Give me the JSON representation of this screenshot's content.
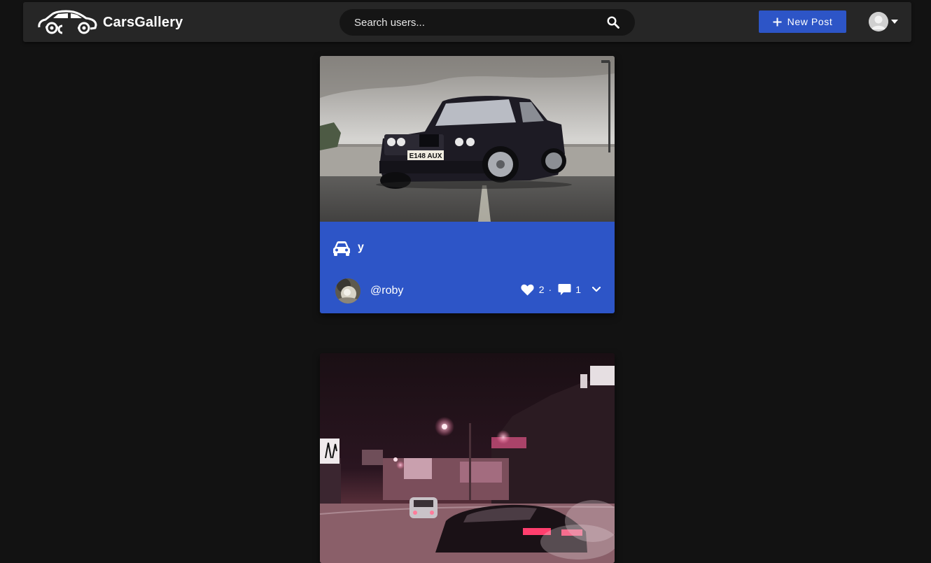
{
  "header": {
    "brand_name": "CarsGallery",
    "brand_icon": "car-logo-icon",
    "search_placeholder": "Search users...",
    "search_icon": "search-icon",
    "new_post_label": "New Post",
    "new_post_icon": "plus-icon",
    "user_avatar_icon": "default-avatar-icon",
    "user_menu_icon": "caret-down-icon"
  },
  "posts": [
    {
      "title": "y",
      "title_icon": "car-icon",
      "author": "@roby",
      "likes": "2",
      "separator": "·",
      "comments": "1",
      "expand_icon": "chevron-down-icon"
    },
    {
      "image_subject": "car-drifting-at-night"
    }
  ],
  "colors": {
    "page_bg": "#121212",
    "nav_bg": "#262626",
    "accent": "#2d55c7",
    "search_bg": "#151515"
  }
}
